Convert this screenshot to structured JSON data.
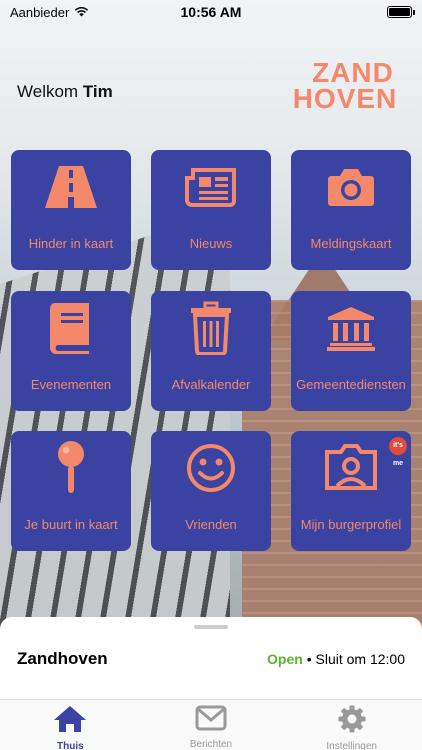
{
  "status_bar": {
    "carrier": "Aanbieder",
    "time": "10:56 AM",
    "battery_level": 1.0
  },
  "header": {
    "welcome_prefix": "Welkom",
    "user_name": "Tim",
    "logo_line1": "ZAND",
    "logo_line2": "HOVEN"
  },
  "colors": {
    "tile_bg": "#3a43a1",
    "tile_fg": "#f4886a",
    "open_green": "#5cb42d"
  },
  "tiles": [
    {
      "label": "Hinder in kaart",
      "icon": "road-icon"
    },
    {
      "label": "Nieuws",
      "icon": "newspaper-icon"
    },
    {
      "label": "Meldingskaart",
      "icon": "camera-icon"
    },
    {
      "label": "Evenementen",
      "icon": "book-icon"
    },
    {
      "label": "Afvalkalender",
      "icon": "trash-icon"
    },
    {
      "label": "Gemeentediensten",
      "icon": "government-building-icon"
    },
    {
      "label": "Je buurt in kaart",
      "icon": "map-pin-icon"
    },
    {
      "label": "Vrienden",
      "icon": "smiley-icon"
    },
    {
      "label": "Mijn burgerprofiel",
      "icon": "profile-photo-icon",
      "badge": "its me"
    }
  ],
  "sheet": {
    "title": "Zandhoven",
    "open_label": "Open",
    "closing_text": "• Sluit om 12:00"
  },
  "tabbar": {
    "tabs": [
      {
        "label": "Thuis",
        "icon": "home-icon",
        "active": true
      },
      {
        "label": "Berichten",
        "icon": "mail-icon",
        "active": false
      },
      {
        "label": "Instellingen",
        "icon": "gear-icon",
        "active": false
      }
    ]
  }
}
